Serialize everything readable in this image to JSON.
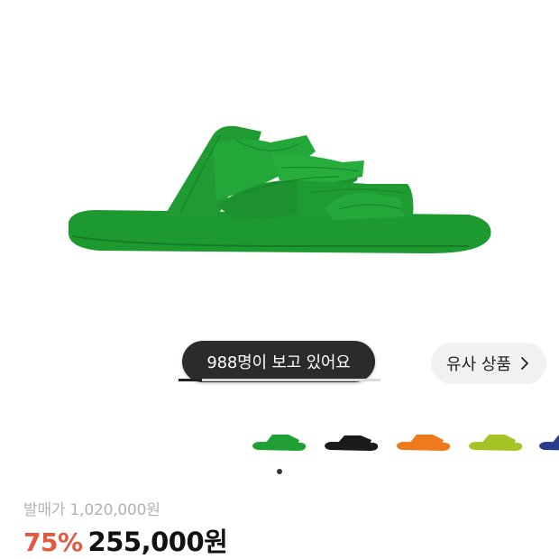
{
  "product": {
    "image_icon": "green-sandal-image",
    "main_color": "#1d9a2f"
  },
  "viewers": {
    "text": "988명이 보고 있어요"
  },
  "similar": {
    "label": "유사 상품",
    "icon": "chevron-right-icon"
  },
  "color_options": [
    {
      "name": "green",
      "color": "#20a034"
    },
    {
      "name": "black",
      "color": "#1a1a1a"
    },
    {
      "name": "orange",
      "color": "#ee7a1d"
    },
    {
      "name": "lime",
      "color": "#a4c424"
    },
    {
      "name": "navy",
      "color": "#283c8c"
    }
  ],
  "pricing": {
    "original": "발매가 1,020,000원",
    "discount": "75%",
    "sale": "255,000원"
  },
  "colors": {
    "discount": "#e4583e",
    "pill_bg": "#2b2b2b"
  }
}
